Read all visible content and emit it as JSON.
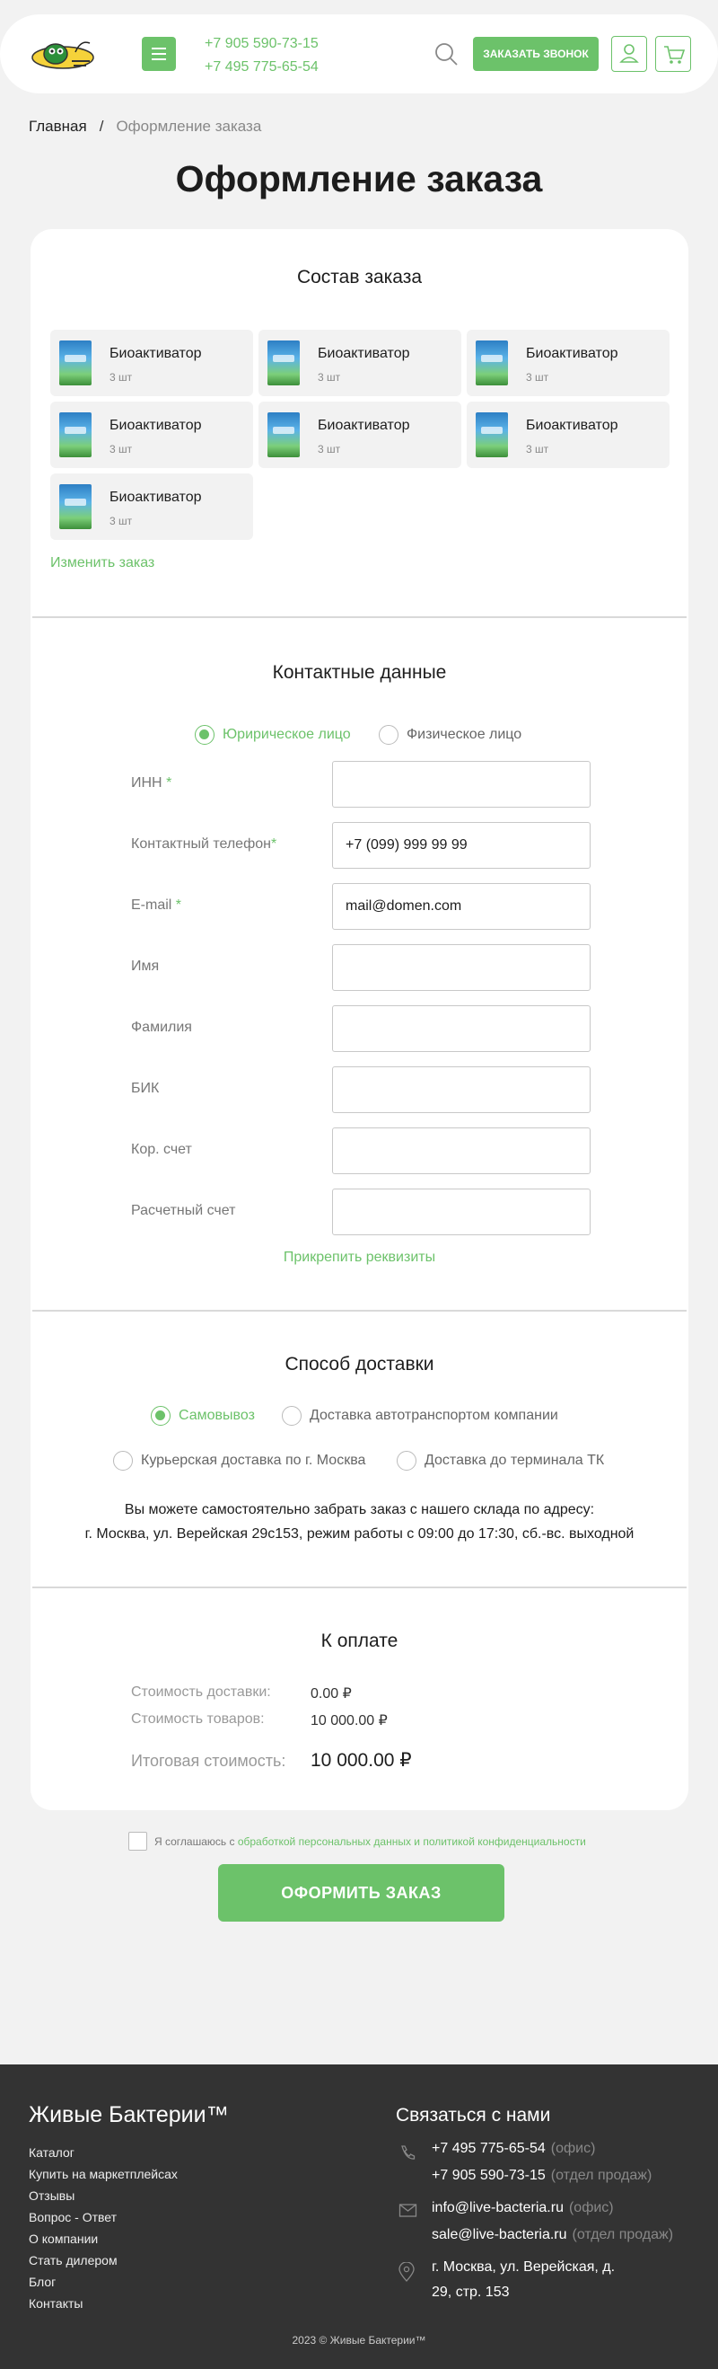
{
  "header": {
    "phones": [
      "+7 905 590-73-15",
      "+7 495 775-65-54"
    ],
    "call_button": "ЗАКАЗАТЬ ЗВОНОК"
  },
  "breadcrumb": {
    "home": "Главная",
    "separator": "/",
    "current": "Оформление заказа"
  },
  "title": "Оформление заказа",
  "order": {
    "title": "Состав заказа",
    "items": [
      {
        "name": "Биоактиватор",
        "qty": "3 шт"
      },
      {
        "name": "Биоактиватор",
        "qty": "3 шт"
      },
      {
        "name": "Биоактиватор",
        "qty": "3 шт"
      },
      {
        "name": "Биоактиватор",
        "qty": "3 шт"
      },
      {
        "name": "Биоактиватор",
        "qty": "3 шт"
      },
      {
        "name": "Биоактиватор",
        "qty": "3 шт"
      },
      {
        "name": "Биоактиватор",
        "qty": "3 шт"
      }
    ],
    "change_link": "Изменить заказ"
  },
  "contacts": {
    "title": "Контактные данные",
    "person_types": [
      "Юририческое лицо",
      "Физическое лицо"
    ],
    "selected_type": "Юририческое лицо",
    "fields": [
      {
        "label": "ИНН",
        "required": "*",
        "value": ""
      },
      {
        "label": "Контактный телефон",
        "required": "*",
        "value": "+7 (099) 999 99 99"
      },
      {
        "label": "E-mail",
        "required": "*",
        "value": "mail@domen.com"
      },
      {
        "label": "Имя",
        "required": "",
        "value": ""
      },
      {
        "label": "Фамилия",
        "required": "",
        "value": ""
      },
      {
        "label": "БИК",
        "required": "",
        "value": ""
      },
      {
        "label": "Кор. счет",
        "required": "",
        "value": ""
      },
      {
        "label": "Расчетный счет",
        "required": "",
        "value": ""
      }
    ],
    "attach_link": "Прикрепить реквизиты"
  },
  "delivery": {
    "title": "Способ доставки",
    "options": [
      "Самовывоз",
      "Доставка автотранспортом компании",
      "Курьерская доставка по г. Москва",
      "Доставка до терминала ТК"
    ],
    "selected": "Самовывоз",
    "pickup_line1": "Вы можете самостоятельно забрать заказ с нашего склада по адресу:",
    "pickup_line2": "г. Москва, ул. Верейская 29с153, режим работы с 09:00 до 17:30, сб.-вс. выходной"
  },
  "payment": {
    "title": "К оплате",
    "delivery_label": "Стоимость доставки:",
    "delivery_value": "0.00 ₽",
    "goods_label": "Стоимость товаров:",
    "goods_value": "10 000.00 ₽",
    "total_label": "Итоговая стоимость:",
    "total_value": "10 000.00 ₽"
  },
  "agreement": {
    "prefix": "Я соглашаюсь с",
    "link": "обработкой персональных данных и политикой конфиденциальности"
  },
  "submit_button": "ОФОРМИТЬ ЗАКАЗ",
  "footer": {
    "brand": "Живые Бактерии™",
    "menu": [
      "Каталог",
      "Купить на маркетплейсах",
      "Отзывы",
      "Вопрос - Ответ",
      "О компании",
      "Стать дилером",
      "Блог",
      "Контакты"
    ],
    "contacts_title": "Связаться с нами",
    "phones": [
      {
        "value": "+7 495 775-65-54",
        "note": "(офис)"
      },
      {
        "value": "+7 905 590-73-15",
        "note": "(отдел продаж)"
      }
    ],
    "emails": [
      {
        "value": "info@live-bacteria.ru",
        "note": "(офис)"
      },
      {
        "value": "sale@live-bacteria.ru",
        "note": "(отдел продаж)"
      }
    ],
    "address_line1": "г. Москва, ул. Верейская, д.",
    "address_line2": "29, стр. 153",
    "copyright": "2023 © Живые Бактерии™"
  },
  "colors": {
    "accent": "#6cc26a",
    "footer_bg": "#333333",
    "page_bg": "#f2f2f2"
  }
}
